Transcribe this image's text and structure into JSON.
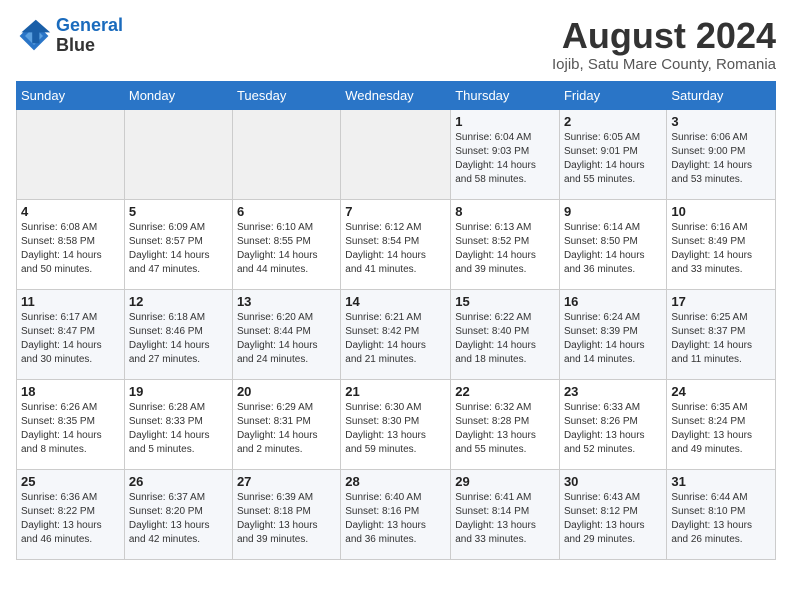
{
  "header": {
    "logo_line1": "General",
    "logo_line2": "Blue",
    "month_year": "August 2024",
    "location": "Iojib, Satu Mare County, Romania"
  },
  "days_of_week": [
    "Sunday",
    "Monday",
    "Tuesday",
    "Wednesday",
    "Thursday",
    "Friday",
    "Saturday"
  ],
  "weeks": [
    [
      {
        "day": "",
        "info": ""
      },
      {
        "day": "",
        "info": ""
      },
      {
        "day": "",
        "info": ""
      },
      {
        "day": "",
        "info": ""
      },
      {
        "day": "1",
        "info": "Sunrise: 6:04 AM\nSunset: 9:03 PM\nDaylight: 14 hours\nand 58 minutes."
      },
      {
        "day": "2",
        "info": "Sunrise: 6:05 AM\nSunset: 9:01 PM\nDaylight: 14 hours\nand 55 minutes."
      },
      {
        "day": "3",
        "info": "Sunrise: 6:06 AM\nSunset: 9:00 PM\nDaylight: 14 hours\nand 53 minutes."
      }
    ],
    [
      {
        "day": "4",
        "info": "Sunrise: 6:08 AM\nSunset: 8:58 PM\nDaylight: 14 hours\nand 50 minutes."
      },
      {
        "day": "5",
        "info": "Sunrise: 6:09 AM\nSunset: 8:57 PM\nDaylight: 14 hours\nand 47 minutes."
      },
      {
        "day": "6",
        "info": "Sunrise: 6:10 AM\nSunset: 8:55 PM\nDaylight: 14 hours\nand 44 minutes."
      },
      {
        "day": "7",
        "info": "Sunrise: 6:12 AM\nSunset: 8:54 PM\nDaylight: 14 hours\nand 41 minutes."
      },
      {
        "day": "8",
        "info": "Sunrise: 6:13 AM\nSunset: 8:52 PM\nDaylight: 14 hours\nand 39 minutes."
      },
      {
        "day": "9",
        "info": "Sunrise: 6:14 AM\nSunset: 8:50 PM\nDaylight: 14 hours\nand 36 minutes."
      },
      {
        "day": "10",
        "info": "Sunrise: 6:16 AM\nSunset: 8:49 PM\nDaylight: 14 hours\nand 33 minutes."
      }
    ],
    [
      {
        "day": "11",
        "info": "Sunrise: 6:17 AM\nSunset: 8:47 PM\nDaylight: 14 hours\nand 30 minutes."
      },
      {
        "day": "12",
        "info": "Sunrise: 6:18 AM\nSunset: 8:46 PM\nDaylight: 14 hours\nand 27 minutes."
      },
      {
        "day": "13",
        "info": "Sunrise: 6:20 AM\nSunset: 8:44 PM\nDaylight: 14 hours\nand 24 minutes."
      },
      {
        "day": "14",
        "info": "Sunrise: 6:21 AM\nSunset: 8:42 PM\nDaylight: 14 hours\nand 21 minutes."
      },
      {
        "day": "15",
        "info": "Sunrise: 6:22 AM\nSunset: 8:40 PM\nDaylight: 14 hours\nand 18 minutes."
      },
      {
        "day": "16",
        "info": "Sunrise: 6:24 AM\nSunset: 8:39 PM\nDaylight: 14 hours\nand 14 minutes."
      },
      {
        "day": "17",
        "info": "Sunrise: 6:25 AM\nSunset: 8:37 PM\nDaylight: 14 hours\nand 11 minutes."
      }
    ],
    [
      {
        "day": "18",
        "info": "Sunrise: 6:26 AM\nSunset: 8:35 PM\nDaylight: 14 hours\nand 8 minutes."
      },
      {
        "day": "19",
        "info": "Sunrise: 6:28 AM\nSunset: 8:33 PM\nDaylight: 14 hours\nand 5 minutes."
      },
      {
        "day": "20",
        "info": "Sunrise: 6:29 AM\nSunset: 8:31 PM\nDaylight: 14 hours\nand 2 minutes."
      },
      {
        "day": "21",
        "info": "Sunrise: 6:30 AM\nSunset: 8:30 PM\nDaylight: 13 hours\nand 59 minutes."
      },
      {
        "day": "22",
        "info": "Sunrise: 6:32 AM\nSunset: 8:28 PM\nDaylight: 13 hours\nand 55 minutes."
      },
      {
        "day": "23",
        "info": "Sunrise: 6:33 AM\nSunset: 8:26 PM\nDaylight: 13 hours\nand 52 minutes."
      },
      {
        "day": "24",
        "info": "Sunrise: 6:35 AM\nSunset: 8:24 PM\nDaylight: 13 hours\nand 49 minutes."
      }
    ],
    [
      {
        "day": "25",
        "info": "Sunrise: 6:36 AM\nSunset: 8:22 PM\nDaylight: 13 hours\nand 46 minutes."
      },
      {
        "day": "26",
        "info": "Sunrise: 6:37 AM\nSunset: 8:20 PM\nDaylight: 13 hours\nand 42 minutes."
      },
      {
        "day": "27",
        "info": "Sunrise: 6:39 AM\nSunset: 8:18 PM\nDaylight: 13 hours\nand 39 minutes."
      },
      {
        "day": "28",
        "info": "Sunrise: 6:40 AM\nSunset: 8:16 PM\nDaylight: 13 hours\nand 36 minutes."
      },
      {
        "day": "29",
        "info": "Sunrise: 6:41 AM\nSunset: 8:14 PM\nDaylight: 13 hours\nand 33 minutes."
      },
      {
        "day": "30",
        "info": "Sunrise: 6:43 AM\nSunset: 8:12 PM\nDaylight: 13 hours\nand 29 minutes."
      },
      {
        "day": "31",
        "info": "Sunrise: 6:44 AM\nSunset: 8:10 PM\nDaylight: 13 hours\nand 26 minutes."
      }
    ]
  ]
}
